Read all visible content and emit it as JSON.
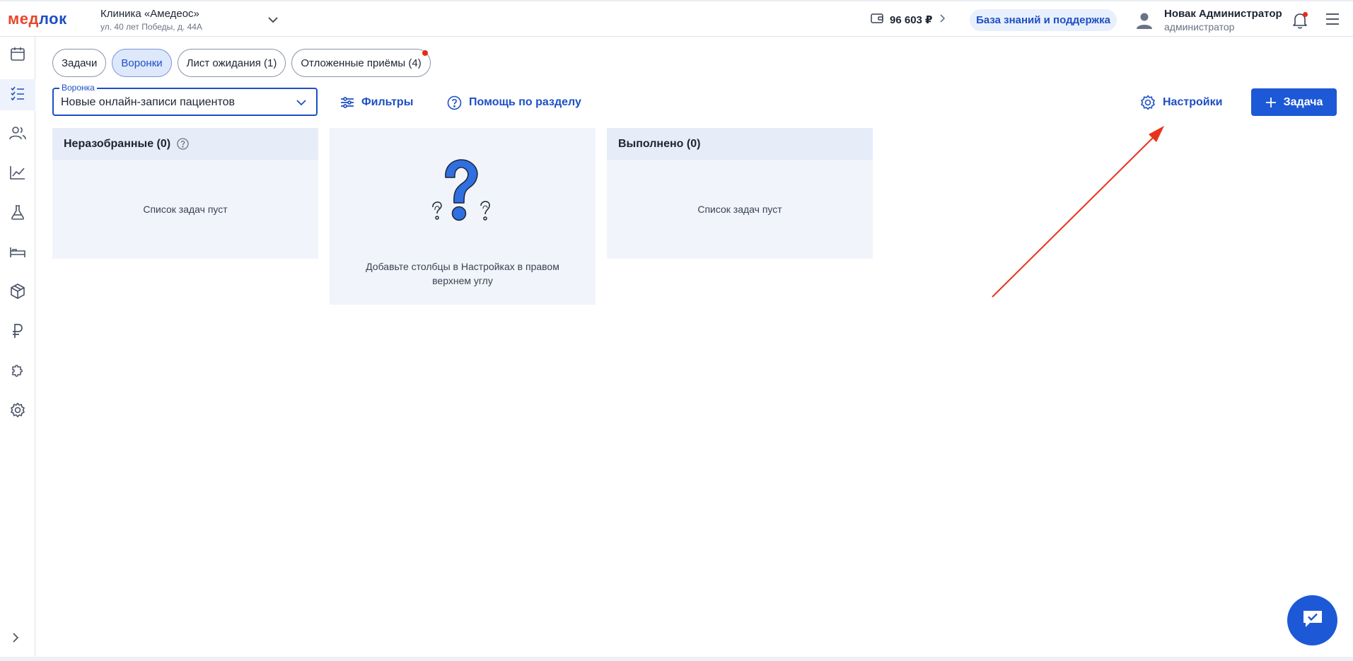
{
  "header": {
    "logo_part1": "мед",
    "logo_part2": "лок",
    "clinic_name": "Клиника «Амедеос»",
    "clinic_address": "ул. 40 лет Победы, д. 44А",
    "balance": "96 603 ₽",
    "knowledge_base": "База знаний и поддержка",
    "user_name": "Новак Администратор",
    "user_role": "администратор"
  },
  "sidebar": {
    "items": [
      {
        "icon": "calendar-icon",
        "active": false
      },
      {
        "icon": "task-list-icon",
        "active": true
      },
      {
        "icon": "patients-icon",
        "active": false
      },
      {
        "icon": "analytics-icon",
        "active": false
      },
      {
        "icon": "lab-flask-icon",
        "active": false
      },
      {
        "icon": "bed-icon",
        "active": false
      },
      {
        "icon": "box-icon",
        "active": false
      },
      {
        "icon": "ruble-icon",
        "active": false
      },
      {
        "icon": "puzzle-icon",
        "active": false
      },
      {
        "icon": "settings-gear-icon",
        "active": false
      }
    ]
  },
  "tabs": [
    {
      "label": "Задачи",
      "active": false
    },
    {
      "label": "Воронки",
      "active": true
    },
    {
      "label": "Лист ожидания (1)",
      "active": false
    },
    {
      "label": "Отложенные приёмы (4)",
      "active": false,
      "notification": true
    }
  ],
  "toolbar": {
    "funnel_label": "Воронка",
    "funnel_value": "Новые онлайн-записи пациентов",
    "filters": "Фильтры",
    "help": "Помощь по разделу",
    "settings": "Настройки",
    "add_task": "Задача"
  },
  "columns": [
    {
      "title": "Неразобранные (0)",
      "empty": "Список задач пуст"
    },
    {
      "title": "Выполнено (0)",
      "empty": "Список задач пуст"
    }
  ],
  "placeholder": {
    "text": "Добавьте столбцы в Настройках в правом верхнем углу"
  },
  "colors": {
    "accent": "#1d59d6",
    "logo_red": "#e8462c",
    "annotation_arrow": "#e8331c"
  }
}
